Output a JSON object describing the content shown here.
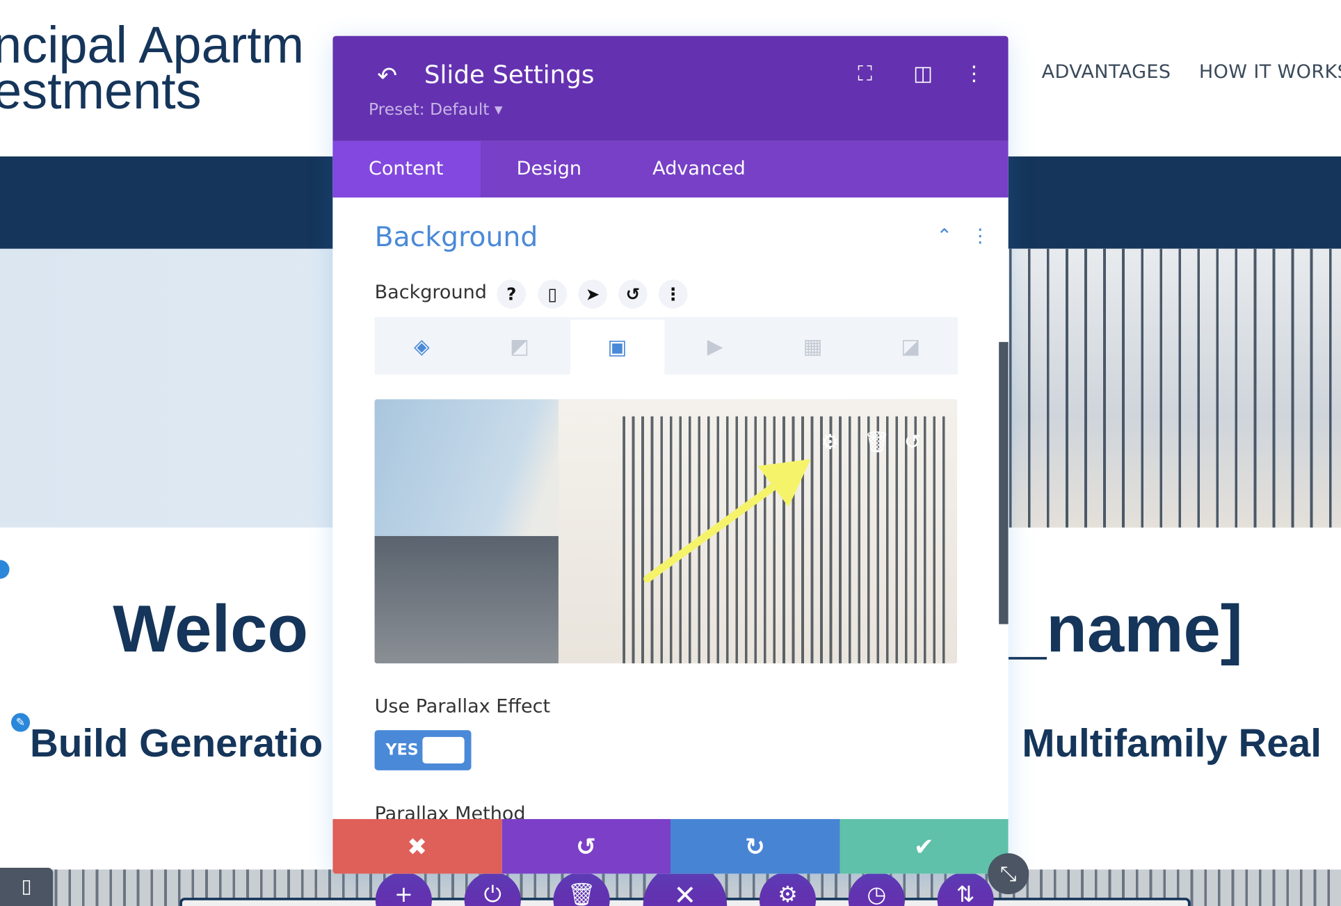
{
  "site": {
    "logo_line1": "ncipal Apartm",
    "logo_line2": "estments",
    "nav": [
      "ADVANTAGES",
      "HOW IT WORKS"
    ],
    "hero_heading_left": "Welco",
    "hero_heading_right": "_name]",
    "hero_sub_left": "Build Generatio",
    "hero_sub_right": "Multifamily Real"
  },
  "modal": {
    "title": "Slide Settings",
    "preset": "Preset: Default",
    "tabs": [
      {
        "label": "Content",
        "active": true
      },
      {
        "label": "Design",
        "active": false
      },
      {
        "label": "Advanced",
        "active": false
      }
    ],
    "section_title": "Background",
    "field_label": "Background",
    "background_types": [
      "color",
      "gradient",
      "image",
      "video",
      "pattern",
      "mask"
    ],
    "active_background_type": "image",
    "parallax_label": "Use Parallax Effect",
    "parallax_toggle": "YES",
    "parallax_method_label": "Parallax Method"
  },
  "colors": {
    "header": "#6432b0",
    "tab_bar": "#7740c7",
    "accent": "#4a89d8",
    "navy": "#15355a",
    "cancel": "#df5f59",
    "undo": "#7b40c7",
    "redo": "#4784d4",
    "save": "#5fc1a9",
    "annotation_arrow": "#f5f36a"
  }
}
